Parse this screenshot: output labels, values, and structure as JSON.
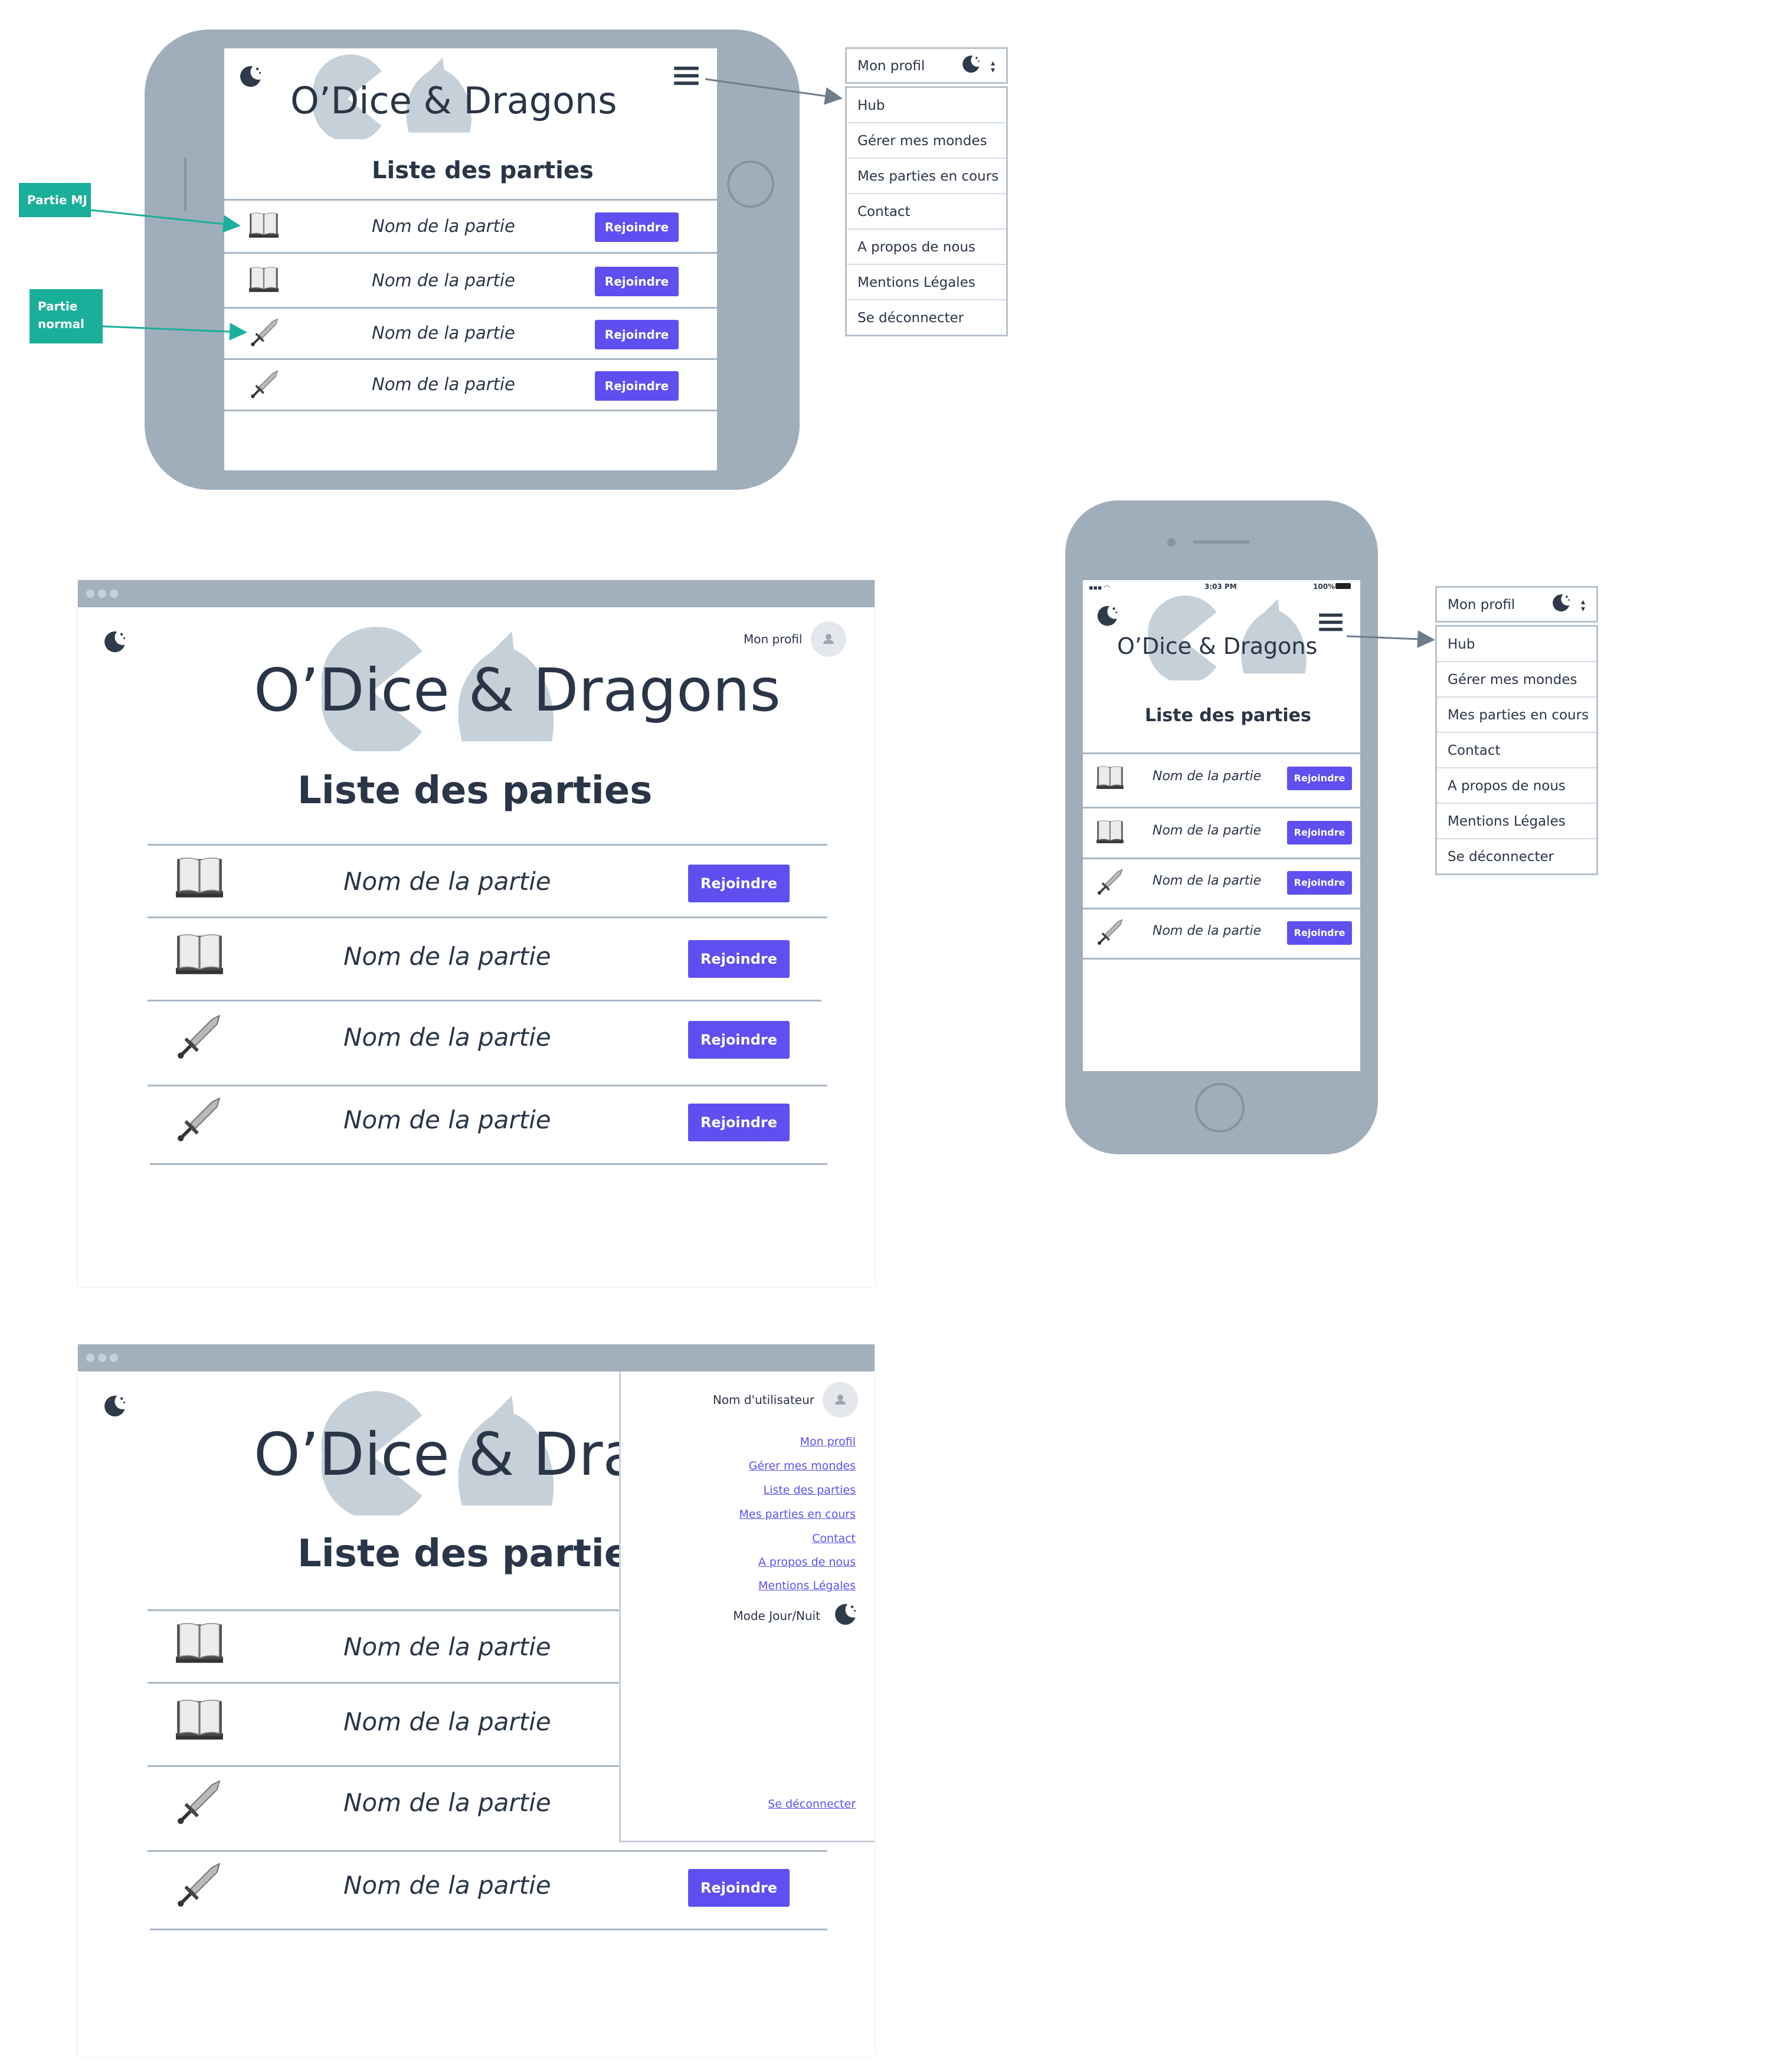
{
  "app": {
    "title": "O’Dice & Dragons",
    "section_title": "Liste des parties"
  },
  "games": [
    {
      "type": "mj",
      "name": "Nom de la partie",
      "icon": "book-icon"
    },
    {
      "type": "mj",
      "name": "Nom de la partie",
      "icon": "book-icon"
    },
    {
      "type": "normal",
      "name": "Nom de la partie",
      "icon": "sword-icon"
    },
    {
      "type": "normal",
      "name": "Nom de la partie",
      "icon": "sword-icon"
    }
  ],
  "join_label": "Rejoindre",
  "annotations": {
    "mj": "Partie MJ",
    "normal": "Partie normal"
  },
  "profile_select": {
    "label": "Mon profil",
    "icon": "moon-icon"
  },
  "menu_items": [
    "Hub",
    "Gérer mes mondes",
    "Mes parties en cours",
    "Contact",
    "A propos de nous",
    "Mentions Légales",
    "Se déconnecter"
  ],
  "header": {
    "profile_label": "Mon profil"
  },
  "phone_status": {
    "time": "3:03 PM",
    "battery": "100%"
  },
  "drawer": {
    "username": "Nom d'utilisateur",
    "links": [
      "Mon profil",
      "Gérer mes mondes",
      "Liste des parties",
      "Mes parties en cours",
      "Contact",
      "A propos de nous",
      "Mentions Légales"
    ],
    "mode_label": "Mode Jour/Nuit",
    "logout": "Se déconnecter"
  },
  "colors": {
    "accent": "#5f4ff1",
    "device": "#a0aebb",
    "annotation": "#1aaf9a",
    "text": "#2a3547"
  }
}
